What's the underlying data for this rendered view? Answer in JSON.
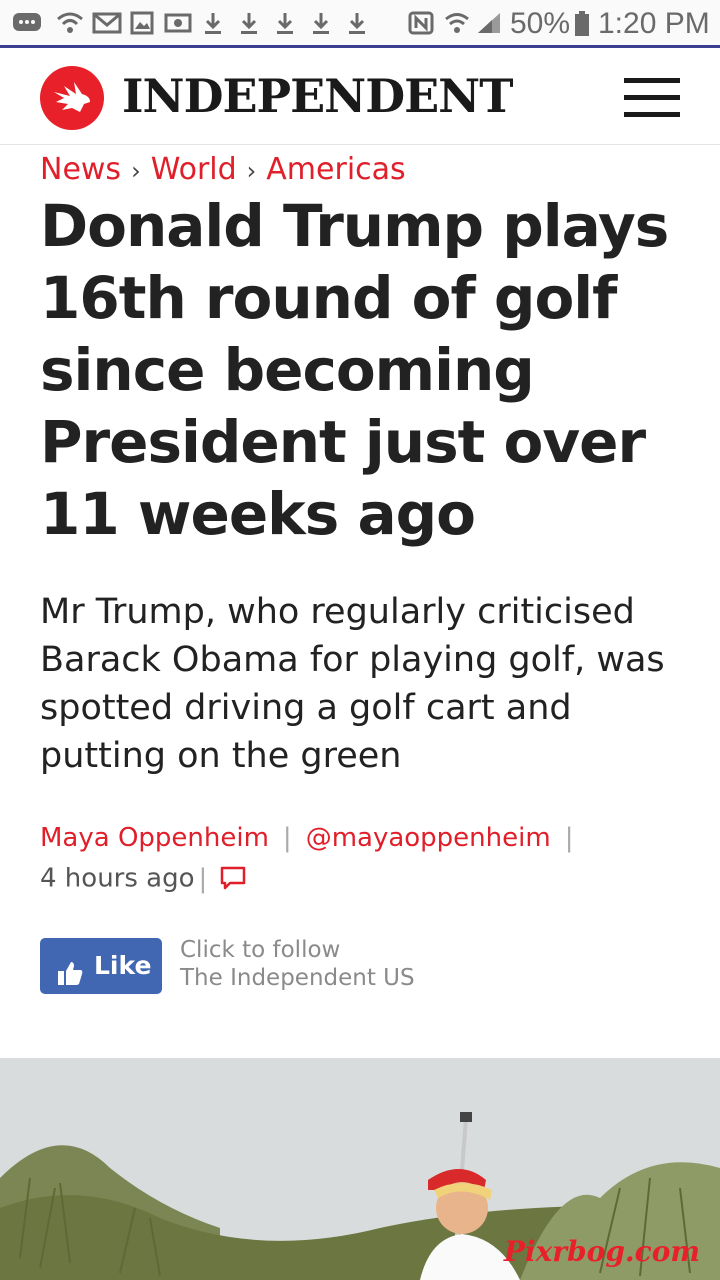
{
  "status_bar": {
    "battery": "50%",
    "time": "1:20 PM"
  },
  "header": {
    "brand": "INDEPENDENT"
  },
  "breadcrumb": [
    "News",
    "World",
    "Americas"
  ],
  "article": {
    "headline": "Donald Trump plays 16th round of golf since becoming President just over 11 weeks ago",
    "standfirst": "Mr Trump, who regularly criticised Barack Obama for playing golf, was spotted driving a golf cart and putting on the green",
    "author": "Maya Oppenheim",
    "handle": "@mayaoppenheim",
    "time_ago": "4 hours ago"
  },
  "social": {
    "like_label": "Like",
    "follow_line1": "Click to follow",
    "follow_line2": "The Independent US"
  },
  "hero_watermark": "Pixrbog.com",
  "colors": {
    "accent": "#e01f2a",
    "facebook": "#4267b2",
    "status_underline": "#3b3f8f"
  }
}
